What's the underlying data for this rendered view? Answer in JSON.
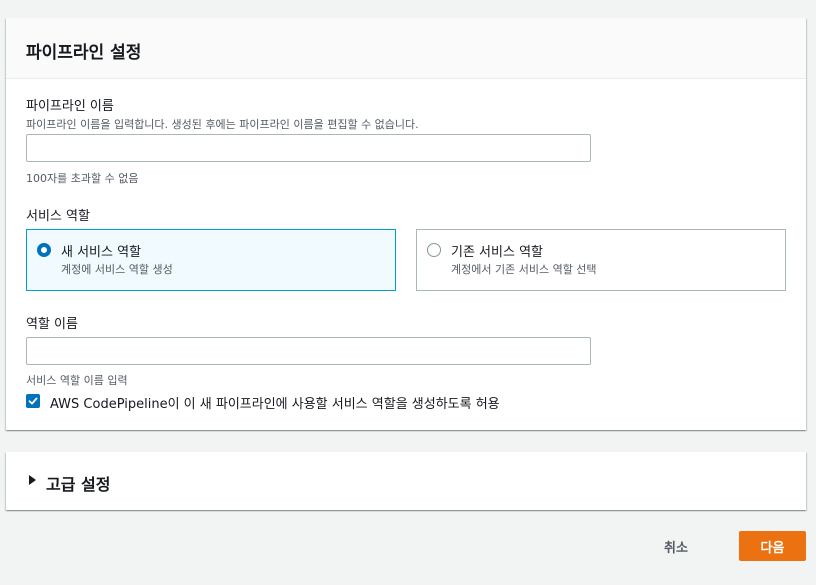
{
  "pipeline_settings": {
    "title": "파이프라인 설정",
    "pipeline_name": {
      "label": "파이프라인 이름",
      "description": "파이프라인 이름을 입력합니다. 생성된 후에는 파이프라인 이름을 편집할 수 없습니다.",
      "value": "",
      "placeholder": "",
      "constraint": "100자를 초과할 수 없음"
    },
    "service_role": {
      "label": "서비스 역할",
      "options": [
        {
          "title": "새 서비스 역할",
          "description": "계정에 서비스 역할 생성",
          "selected": true
        },
        {
          "title": "기존 서비스 역할",
          "description": "계정에서 기존 서비스 역할 선택",
          "selected": false
        }
      ]
    },
    "role_name": {
      "label": "역할 이름",
      "value": "",
      "placeholder": "",
      "description": "서비스 역할 이름 입력"
    },
    "allow_checkbox": {
      "label": "AWS CodePipeline이 이 새 파이프라인에 사용할 서비스 역할을 생성하도록 허용",
      "checked": true
    }
  },
  "advanced_settings": {
    "title": "고급 설정",
    "expanded": false
  },
  "footer": {
    "cancel_label": "취소",
    "next_label": "다음"
  },
  "colors": {
    "accent": "#0073bb",
    "primary_button": "#ec7211",
    "selected_tile_border": "#00a1c9",
    "selected_tile_bg": "#f1faff"
  }
}
